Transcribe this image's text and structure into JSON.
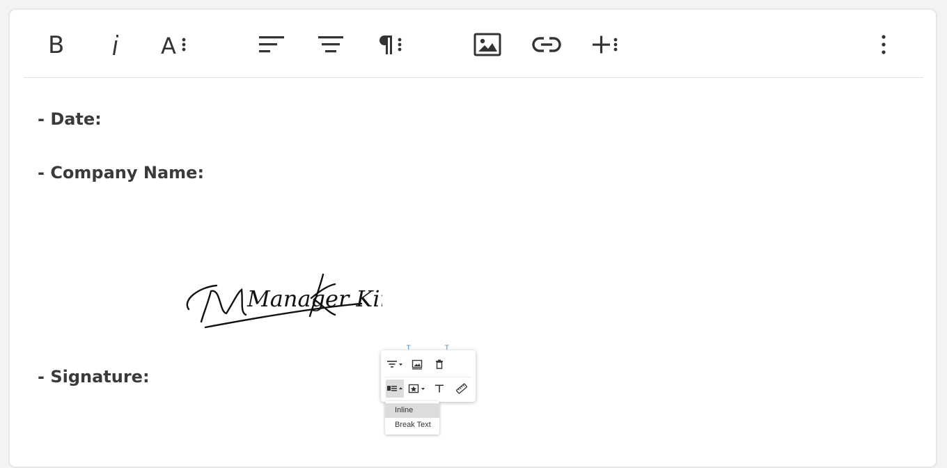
{
  "toolbar": {
    "buttons": [
      {
        "name": "bold-icon"
      },
      {
        "name": "italic-icon"
      },
      {
        "name": "font-size-icon"
      },
      {
        "name": "align-left-icon"
      },
      {
        "name": "align-center-icon"
      },
      {
        "name": "paragraph-format-icon"
      },
      {
        "name": "insert-image-icon"
      },
      {
        "name": "insert-link-icon"
      },
      {
        "name": "insert-more-icon"
      },
      {
        "name": "more-options-icon"
      }
    ]
  },
  "content": {
    "date_label": "- Date:",
    "company_label": "- Company Name:",
    "signature_label": "- Signature:",
    "signature_text": "Manager Kim"
  },
  "image_popup": {
    "row1": [
      "align-icon",
      "replace-image-icon",
      "delete-icon"
    ],
    "row2": [
      "display-icon",
      "style-icon",
      "alt-text-icon",
      "resize-icon"
    ],
    "display_options": [
      "Inline",
      "Break Text"
    ],
    "selected_display": "Inline"
  },
  "colors": {
    "text": "#3a3a3a",
    "icon": "#333333",
    "handle": "#2a8ad8"
  }
}
